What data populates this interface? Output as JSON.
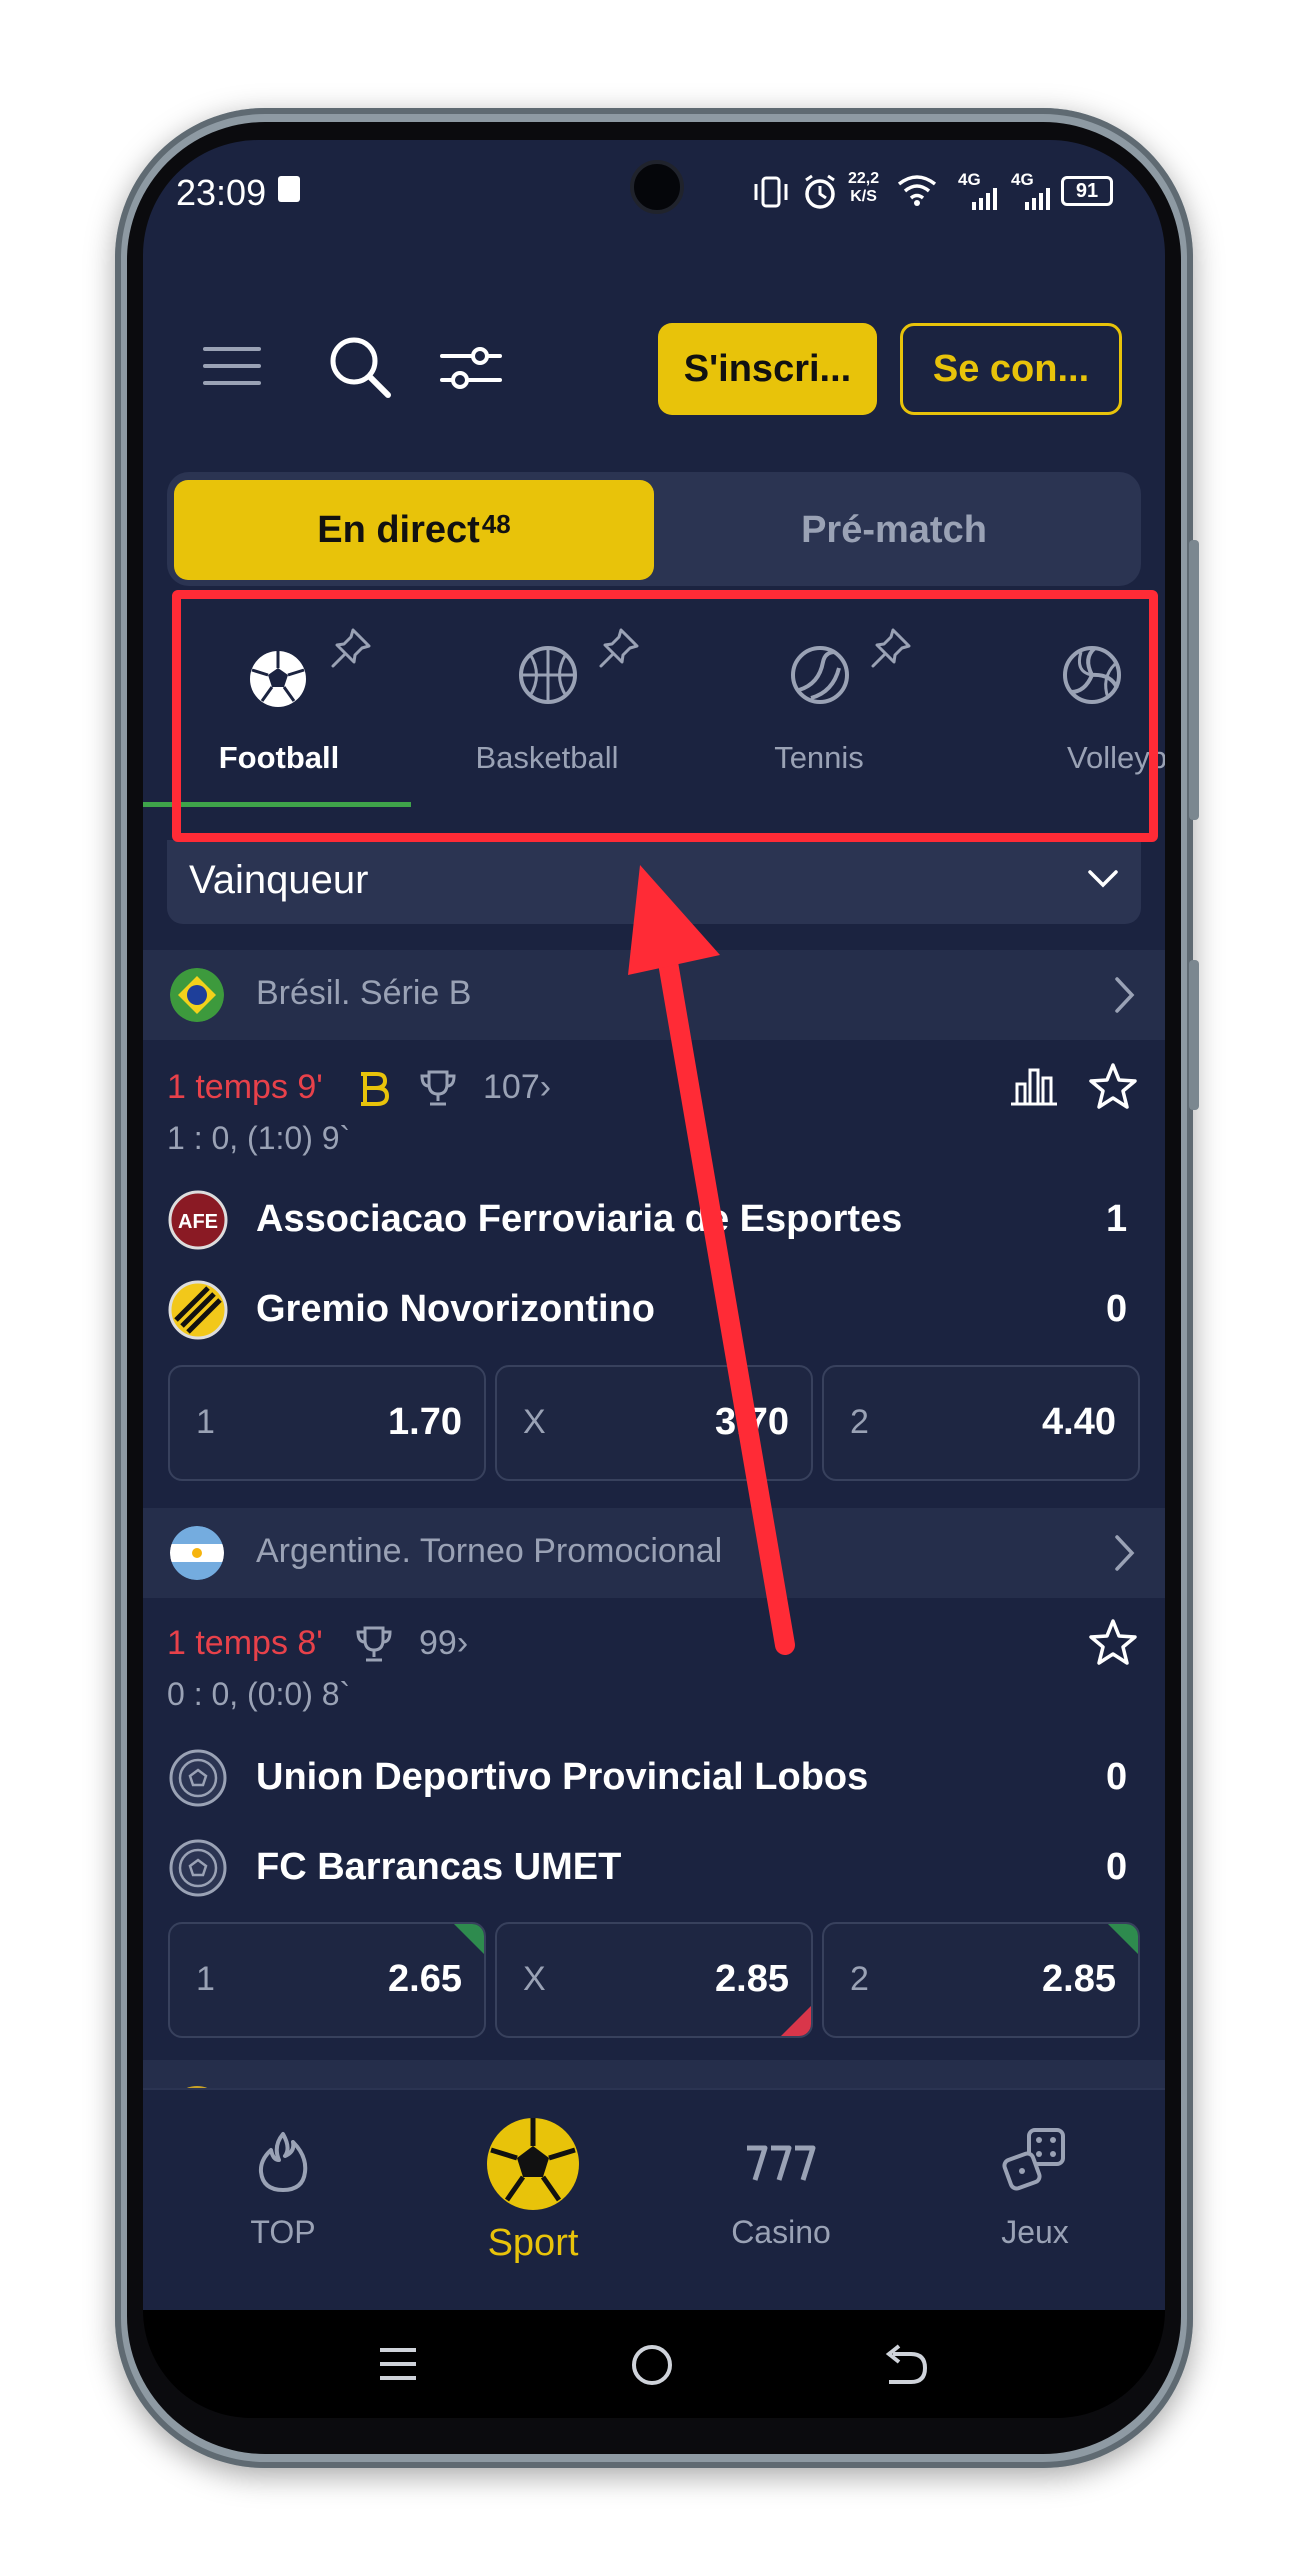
{
  "status_bar": {
    "time": "23:09",
    "net_speed": "22,2",
    "net_unit": "K/S",
    "sig1": "4G",
    "sig2": "4G",
    "battery": "91"
  },
  "header": {
    "signup_label": "S'inscri...",
    "login_label": "Se con..."
  },
  "mode_tabs": {
    "live_label": "En direct",
    "live_count": "48",
    "prematch_label": "Pré-match"
  },
  "sports": [
    {
      "label": "Football"
    },
    {
      "label": "Basketball"
    },
    {
      "label": "Tennis"
    },
    {
      "label": "Volleyba"
    }
  ],
  "market": {
    "selected": "Vainqueur"
  },
  "leagues": [
    {
      "name": "Brésil. Série B",
      "match": {
        "time": "1 temps 9'",
        "markets": "107",
        "score_line": "1 : 0, (1:0) 9`",
        "team1": "Associacao Ferroviaria de Esportes",
        "team2": "Gremio Novorizontino",
        "score1": "1",
        "score2": "0",
        "odds": [
          {
            "label": "1",
            "value": "1.70"
          },
          {
            "label": "X",
            "value": "3.70"
          },
          {
            "label": "2",
            "value": "4.40"
          }
        ]
      }
    },
    {
      "name": "Argentine. Torneo Promocional",
      "match": {
        "time": "1 temps 8'",
        "markets": "99",
        "score_line": "0 : 0, (0:0) 8`",
        "team1": "Union Deportivo Provincial Lobos",
        "team2": "FC Barrancas UMET",
        "score1": "0",
        "score2": "0",
        "odds": [
          {
            "label": "1",
            "value": "2.65"
          },
          {
            "label": "X",
            "value": "2.85"
          },
          {
            "label": "2",
            "value": "2.85"
          }
        ]
      }
    }
  ],
  "bottom_nav": [
    {
      "label": "TOP"
    },
    {
      "label": "Sport"
    },
    {
      "label": "Casino"
    },
    {
      "label": "Jeux"
    }
  ],
  "colors": {
    "background": "#1b2340",
    "accent": "#e8c30a",
    "live_red": "#e8414a",
    "active_underline": "#3fa44a",
    "annotation_red": "#ff2b36"
  }
}
